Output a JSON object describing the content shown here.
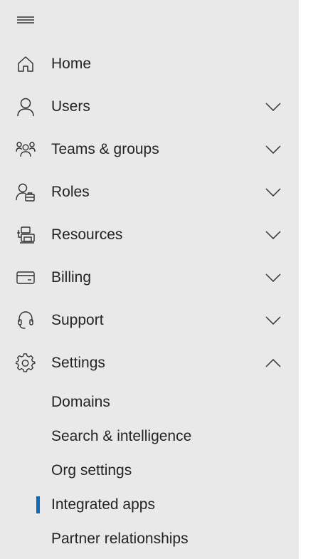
{
  "nav": {
    "items": [
      {
        "label": "Home",
        "icon": "home-icon",
        "expandable": false
      },
      {
        "label": "Users",
        "icon": "user-icon",
        "expandable": true,
        "expanded": false
      },
      {
        "label": "Teams & groups",
        "icon": "teams-icon",
        "expandable": true,
        "expanded": false
      },
      {
        "label": "Roles",
        "icon": "roles-icon",
        "expandable": true,
        "expanded": false
      },
      {
        "label": "Resources",
        "icon": "resources-icon",
        "expandable": true,
        "expanded": false
      },
      {
        "label": "Billing",
        "icon": "billing-card-icon",
        "expandable": true,
        "expanded": false
      },
      {
        "label": "Support",
        "icon": "headset-icon",
        "expandable": true,
        "expanded": false
      },
      {
        "label": "Settings",
        "icon": "gear-icon",
        "expandable": true,
        "expanded": true
      }
    ],
    "settings_children": [
      {
        "label": "Domains",
        "active": false
      },
      {
        "label": "Search & intelligence",
        "active": false
      },
      {
        "label": "Org settings",
        "active": false
      },
      {
        "label": "Integrated apps",
        "active": true
      },
      {
        "label": "Partner relationships",
        "active": false
      }
    ]
  },
  "colors": {
    "nav_background": "#e9e9e9",
    "text": "#252423",
    "active_indicator": "#0f6cbd"
  }
}
